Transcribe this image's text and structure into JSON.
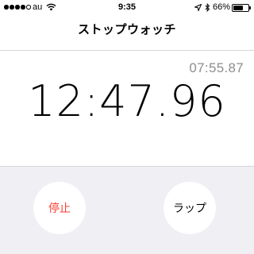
{
  "status_bar": {
    "carrier": "au",
    "time": "9:35",
    "battery_percent_text": "66%",
    "battery_level": 0.66,
    "signal_bars_filled": 4,
    "signal_bars_total": 5,
    "icons": [
      "signal-dots-icon",
      "wifi-icon",
      "location-icon",
      "bluetooth-icon",
      "battery-icon"
    ]
  },
  "nav": {
    "title": "ストップウォッチ"
  },
  "timer": {
    "lap_time": "07:55.87",
    "main_time": "12:47.96"
  },
  "controls": {
    "stop_label": "停止",
    "lap_label": "ラップ"
  },
  "colors": {
    "stop_accent": "#ff3b30",
    "lap_time_gray": "#8e8e8e",
    "panel_background": "#efeff4"
  }
}
